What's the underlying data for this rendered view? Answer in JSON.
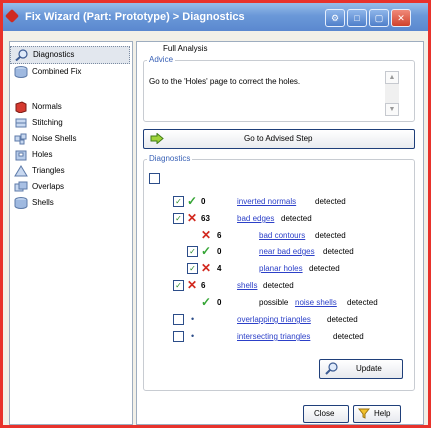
{
  "window": {
    "title": "Fix Wizard (Part: Prototype) > Diagnostics"
  },
  "sidebar": {
    "items": [
      {
        "label": "Diagnostics",
        "icon": "magnifier-icon",
        "selected": true
      },
      {
        "label": "Combined Fix",
        "icon": "combined-fix-icon",
        "selected": false
      },
      {
        "label": "Normals",
        "icon": "normals-icon",
        "selected": false
      },
      {
        "label": "Stitching",
        "icon": "stitching-icon",
        "selected": false
      },
      {
        "label": "Noise Shells",
        "icon": "noise-shells-icon",
        "selected": false
      },
      {
        "label": "Holes",
        "icon": "holes-icon",
        "selected": false
      },
      {
        "label": "Triangles",
        "icon": "triangles-icon",
        "selected": false
      },
      {
        "label": "Overlaps",
        "icon": "overlaps-icon",
        "selected": false
      },
      {
        "label": "Shells",
        "icon": "shells-icon",
        "selected": false
      }
    ]
  },
  "advice": {
    "group_title": "Advice",
    "text": "Go to the 'Holes' page to correct the holes."
  },
  "go_button": {
    "label": "Go to Advised Step"
  },
  "diagnostics": {
    "group_title": "Diagnostics",
    "full_analysis_label": "Full Analysis",
    "rows": [
      {
        "checked": true,
        "status": "ok",
        "count": "0",
        "link": "inverted normals",
        "pre": "",
        "suffix": "detected"
      },
      {
        "checked": true,
        "status": "error",
        "count": "63",
        "link": "bad edges",
        "pre": "",
        "suffix": "detected"
      },
      {
        "checked": null,
        "status": "error",
        "count": "6",
        "link": "bad contours",
        "pre": "",
        "suffix": "detected"
      },
      {
        "checked": true,
        "status": "ok",
        "count": "0",
        "link": "near bad edges",
        "pre": "",
        "suffix": "detected"
      },
      {
        "checked": true,
        "status": "error",
        "count": "4",
        "link": "planar holes",
        "pre": "",
        "suffix": "detected"
      },
      {
        "checked": true,
        "status": "error",
        "count": "6",
        "link": "shells",
        "pre": "",
        "suffix": "detected"
      },
      {
        "checked": null,
        "status": "ok",
        "count": "0",
        "link": "noise shells",
        "pre": "possible",
        "suffix": "detected"
      },
      {
        "checked": false,
        "status": "unknown",
        "count": "",
        "link": "overlapping triangles",
        "pre": "",
        "suffix": "detected"
      },
      {
        "checked": false,
        "status": "unknown",
        "count": "",
        "link": "intersecting triangles",
        "pre": "",
        "suffix": "detected"
      }
    ]
  },
  "buttons": {
    "update": "Update",
    "close": "Close",
    "help": "Help"
  }
}
